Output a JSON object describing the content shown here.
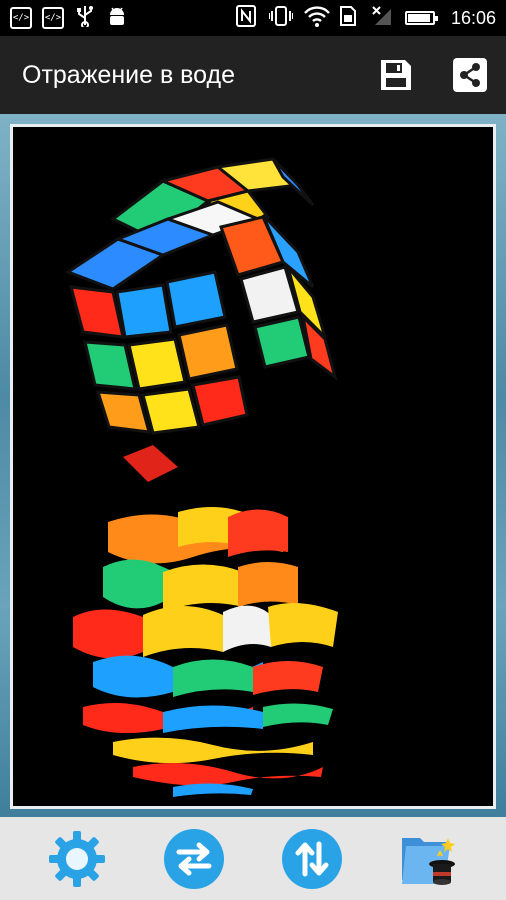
{
  "status_bar": {
    "time": "16:06",
    "left_icons": [
      "code-icon",
      "code-icon",
      "usb-icon",
      "android-icon"
    ],
    "right_icons": [
      "nfc-icon",
      "vibrate-icon",
      "wifi-icon",
      "sim-icon",
      "no-signal-icon",
      "battery-icon"
    ]
  },
  "app_bar": {
    "title": "Отражение в воде",
    "actions": [
      "save-icon",
      "share-icon"
    ]
  },
  "bottom_toolbar": {
    "buttons": [
      "settings-gear-icon",
      "swap-horizontal-icon",
      "swap-vertical-icon",
      "gallery-magic-icon"
    ]
  },
  "colors": {
    "status_bar_bg": "#000000",
    "app_bar_bg": "#222222",
    "toolbar_bg": "#e6e6e6",
    "accent_blue": "#2aa3e6"
  }
}
